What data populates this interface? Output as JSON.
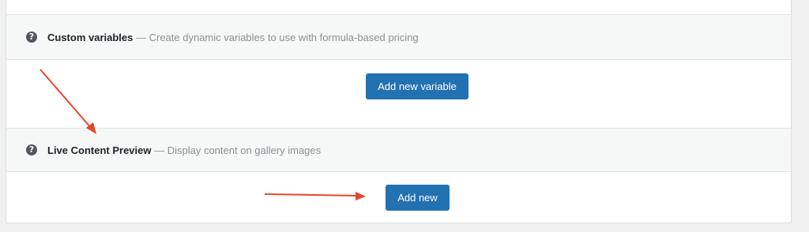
{
  "sections": [
    {
      "icon": "help-icon",
      "icon_glyph": "?",
      "title": "Custom variables",
      "separator": " — ",
      "description": "Create dynamic variables to use with formula-based pricing",
      "button_label": "Add new variable"
    },
    {
      "icon": "help-icon",
      "icon_glyph": "?",
      "title": "Live Content Preview",
      "separator": " — ",
      "description": "Display content on gallery images",
      "button_label": "Add new"
    }
  ],
  "annotations": {
    "arrow_color": "#e8452c"
  },
  "colors": {
    "accent": "#2271b1",
    "header_bg": "#f6f7f7",
    "page_bg": "#f0f0f1"
  }
}
